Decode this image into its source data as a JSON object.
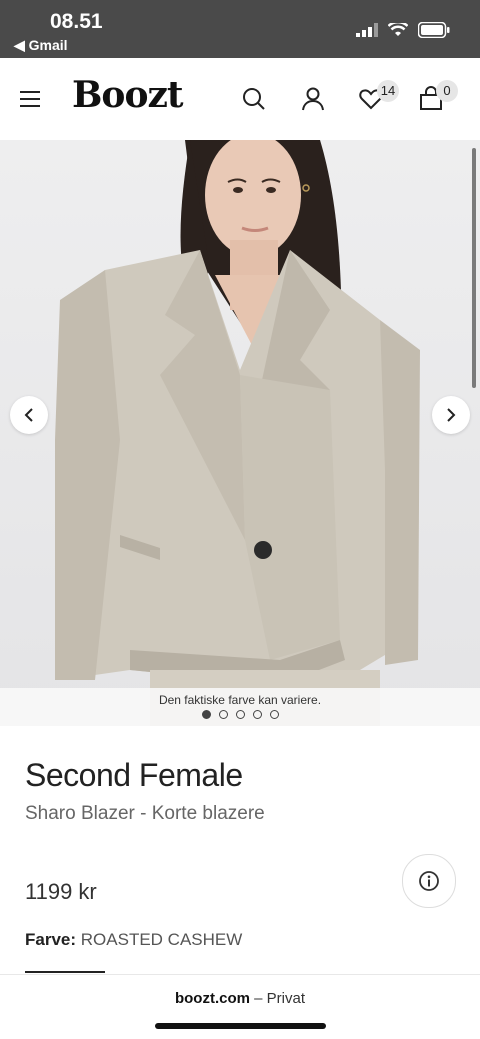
{
  "status_bar": {
    "time": "08.51",
    "back_label": "◀ Gmail"
  },
  "header": {
    "logo": "Boozt",
    "wishlist_count": "14",
    "cart_count": "0"
  },
  "gallery": {
    "caption": "Den faktiske farve kan variere.",
    "total_images": 5,
    "active_index": 0
  },
  "product": {
    "brand": "Second Female",
    "name": "Sharo Blazer - Korte blazere",
    "price": "1199 kr",
    "color_label": "Farve:",
    "color_value": "ROASTED CASHEW"
  },
  "browser": {
    "domain": "boozt.com",
    "mode": "– Privat"
  },
  "colors": {
    "status_bg": "#4a4a4a",
    "blazer": "#cfc9bd",
    "text_primary": "#222222"
  }
}
